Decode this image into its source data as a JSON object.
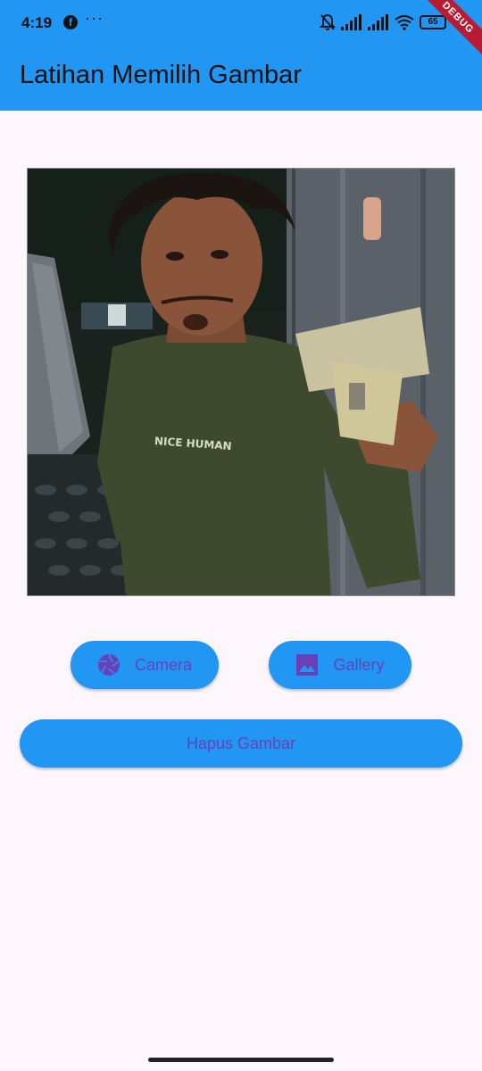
{
  "status_bar": {
    "time": "4:19",
    "app_icon": "facebook-icon",
    "more": "···",
    "battery": "65"
  },
  "debug_banner": "DEBUG",
  "app_bar": {
    "title": "Latihan Memilih Gambar",
    "color": "#2196f3"
  },
  "photo": {
    "shirt_text": "NICE HUMAN"
  },
  "buttons": {
    "camera": {
      "label": "Camera",
      "icon": "camera-shutter-icon"
    },
    "gallery": {
      "label": "Gallery",
      "icon": "image-icon"
    },
    "hapus": {
      "label": "Hapus Gambar"
    }
  },
  "colors": {
    "accent": "#2196f3",
    "button_text": "#6a40b8",
    "background": "#fdf7fd"
  }
}
